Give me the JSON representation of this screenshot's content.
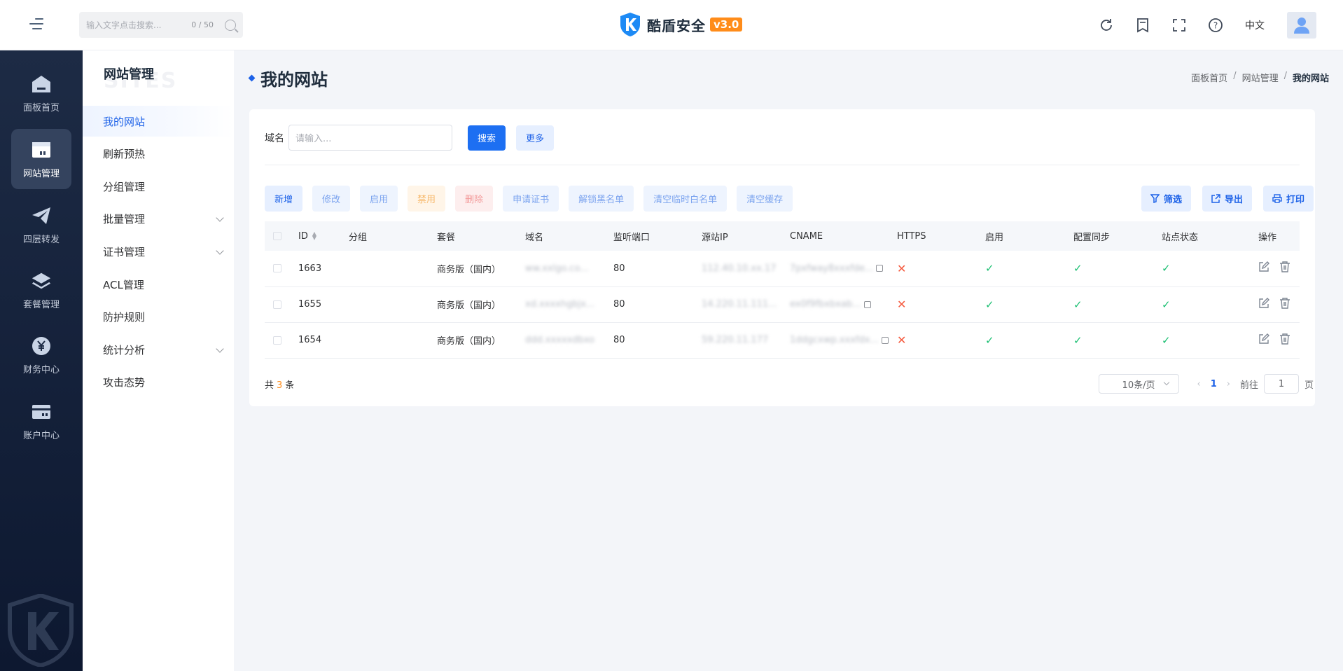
{
  "header": {
    "search_placeholder": "输入文字点击搜索...",
    "search_count": "0 / 50",
    "brand_name": "酷盾安全",
    "brand_version": "v3.0",
    "lang": "中文"
  },
  "darknav": [
    {
      "label": "面板首页",
      "icon": "home-icon"
    },
    {
      "label": "网站管理",
      "icon": "website-icon"
    },
    {
      "label": "四层转发",
      "icon": "paper-plane-icon"
    },
    {
      "label": "套餐管理",
      "icon": "layers-icon"
    },
    {
      "label": "财务中心",
      "icon": "yen-icon"
    },
    {
      "label": "账户中心",
      "icon": "card-icon"
    }
  ],
  "submenu": {
    "title": "网站管理",
    "items": [
      {
        "label": "我的网站"
      },
      {
        "label": "刷新预热"
      },
      {
        "label": "分组管理"
      },
      {
        "label": "批量管理"
      },
      {
        "label": "证书管理"
      },
      {
        "label": "ACL管理"
      },
      {
        "label": "防护规则"
      },
      {
        "label": "统计分析"
      },
      {
        "label": "攻击态势"
      }
    ]
  },
  "page": {
    "title": "我的网站",
    "breadcrumb": [
      "面板首页",
      "网站管理",
      "我的网站"
    ]
  },
  "filter": {
    "label": "域名",
    "placeholder": "请输入...",
    "search_btn": "搜索",
    "more_btn": "更多"
  },
  "toolbar": {
    "add": "新增",
    "edit": "修改",
    "enable": "启用",
    "disable": "禁用",
    "delete": "删除",
    "cert": "申请证书",
    "unblock": "解锁黑名单",
    "clear_whitelist": "清空临时白名单",
    "clear_cache": "清空缓存",
    "filter": "筛选",
    "export": "导出",
    "print": "打印"
  },
  "table": {
    "columns": [
      "ID",
      "分组",
      "套餐",
      "域名",
      "监听端口",
      "源站IP",
      "CNAME",
      "HTTPS",
      "启用",
      "配置同步",
      "站点状态",
      "操作"
    ],
    "rows": [
      {
        "id": "1663",
        "group": "",
        "plan": "商务版（国内）",
        "domain": "ww.xxlgo.co...",
        "port": "80",
        "ip": "112.40.10.xx.17",
        "cname": "7pxfway8xxxfde...",
        "https": "✕",
        "enabled": "✓",
        "sync": "✓",
        "status": "✓"
      },
      {
        "id": "1655",
        "group": "",
        "plan": "商务版（国内）",
        "domain": "xd.xxxxhgbjx...",
        "port": "80",
        "ip": "14.220.11.111...",
        "cname": "ex0f9fbxbxab...",
        "https": "✕",
        "enabled": "✓",
        "sync": "✓",
        "status": "✓"
      },
      {
        "id": "1654",
        "group": "",
        "plan": "商务版（国内）",
        "domain": "ddd.xxxxxdbxo",
        "port": "80",
        "ip": "59.220.11.177",
        "cname": "1ddgcxwp.xxxfdx...",
        "https": "✕",
        "enabled": "✓",
        "sync": "✓",
        "status": "✓"
      }
    ]
  },
  "footer": {
    "total_prefix": "共",
    "total": "3",
    "total_suffix": "条",
    "page_size": "10条/页",
    "current_page": "1",
    "goto_label": "前往",
    "goto_value": "1",
    "page_suffix": "页"
  }
}
